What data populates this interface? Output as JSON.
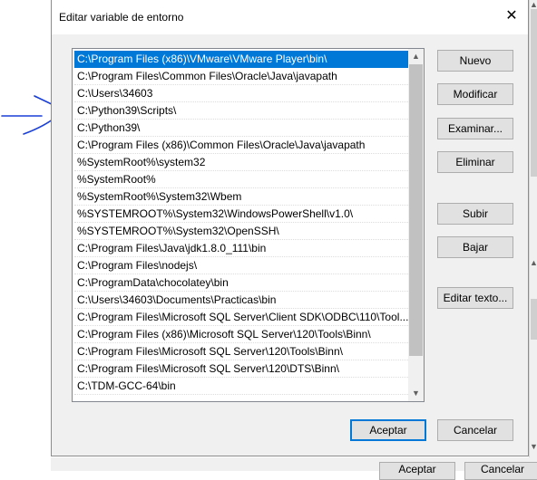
{
  "dialog": {
    "title": "Editar variable de entorno",
    "close_glyph": "✕"
  },
  "list": {
    "selected_index": 0,
    "items": [
      "C:\\Program Files (x86)\\VMware\\VMware Player\\bin\\",
      "C:\\Program Files\\Common Files\\Oracle\\Java\\javapath",
      "C:\\Users\\34603",
      "C:\\Python39\\Scripts\\",
      "C:\\Python39\\",
      "C:\\Program Files (x86)\\Common Files\\Oracle\\Java\\javapath",
      "%SystemRoot%\\system32",
      "%SystemRoot%",
      "%SystemRoot%\\System32\\Wbem",
      "%SYSTEMROOT%\\System32\\WindowsPowerShell\\v1.0\\",
      "%SYSTEMROOT%\\System32\\OpenSSH\\",
      "C:\\Program Files\\Java\\jdk1.8.0_111\\bin",
      "C:\\Program Files\\nodejs\\",
      "C:\\ProgramData\\chocolatey\\bin",
      "C:\\Users\\34603\\Documents\\Practicas\\bin",
      "C:\\Program Files\\Microsoft SQL Server\\Client SDK\\ODBC\\110\\Tool...",
      "C:\\Program Files (x86)\\Microsoft SQL Server\\120\\Tools\\Binn\\",
      "C:\\Program Files\\Microsoft SQL Server\\120\\Tools\\Binn\\",
      "C:\\Program Files\\Microsoft SQL Server\\120\\DTS\\Binn\\",
      "C:\\TDM-GCC-64\\bin"
    ]
  },
  "buttons": {
    "nuevo": "Nuevo",
    "modificar": "Modificar",
    "examinar": "Examinar...",
    "eliminar": "Eliminar",
    "subir": "Subir",
    "bajar": "Bajar",
    "editar_texto": "Editar texto...",
    "aceptar": "Aceptar",
    "cancelar": "Cancelar"
  },
  "background": {
    "aceptar": "Aceptar",
    "cancelar": "Cancelar"
  },
  "colors": {
    "selection": "#0078d7",
    "annotation_pen": "#1a3fd6"
  }
}
